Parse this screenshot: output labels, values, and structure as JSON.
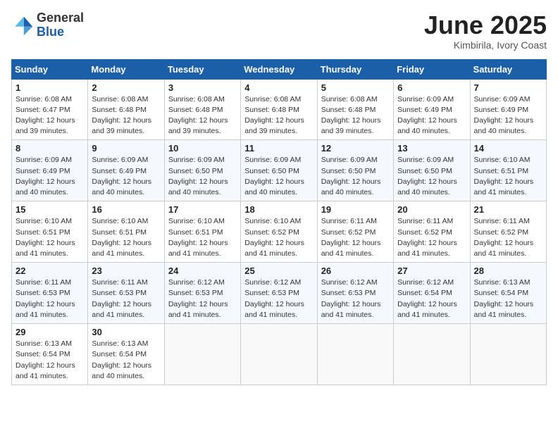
{
  "header": {
    "logo_general": "General",
    "logo_blue": "Blue",
    "month_title": "June 2025",
    "location": "Kimbirila, Ivory Coast"
  },
  "calendar": {
    "days_of_week": [
      "Sunday",
      "Monday",
      "Tuesday",
      "Wednesday",
      "Thursday",
      "Friday",
      "Saturday"
    ],
    "weeks": [
      [
        {
          "day": "1",
          "info": "Sunrise: 6:08 AM\nSunset: 6:47 PM\nDaylight: 12 hours\nand 39 minutes."
        },
        {
          "day": "2",
          "info": "Sunrise: 6:08 AM\nSunset: 6:48 PM\nDaylight: 12 hours\nand 39 minutes."
        },
        {
          "day": "3",
          "info": "Sunrise: 6:08 AM\nSunset: 6:48 PM\nDaylight: 12 hours\nand 39 minutes."
        },
        {
          "day": "4",
          "info": "Sunrise: 6:08 AM\nSunset: 6:48 PM\nDaylight: 12 hours\nand 39 minutes."
        },
        {
          "day": "5",
          "info": "Sunrise: 6:08 AM\nSunset: 6:48 PM\nDaylight: 12 hours\nand 39 minutes."
        },
        {
          "day": "6",
          "info": "Sunrise: 6:09 AM\nSunset: 6:49 PM\nDaylight: 12 hours\nand 40 minutes."
        },
        {
          "day": "7",
          "info": "Sunrise: 6:09 AM\nSunset: 6:49 PM\nDaylight: 12 hours\nand 40 minutes."
        }
      ],
      [
        {
          "day": "8",
          "info": "Sunrise: 6:09 AM\nSunset: 6:49 PM\nDaylight: 12 hours\nand 40 minutes."
        },
        {
          "day": "9",
          "info": "Sunrise: 6:09 AM\nSunset: 6:49 PM\nDaylight: 12 hours\nand 40 minutes."
        },
        {
          "day": "10",
          "info": "Sunrise: 6:09 AM\nSunset: 6:50 PM\nDaylight: 12 hours\nand 40 minutes."
        },
        {
          "day": "11",
          "info": "Sunrise: 6:09 AM\nSunset: 6:50 PM\nDaylight: 12 hours\nand 40 minutes."
        },
        {
          "day": "12",
          "info": "Sunrise: 6:09 AM\nSunset: 6:50 PM\nDaylight: 12 hours\nand 40 minutes."
        },
        {
          "day": "13",
          "info": "Sunrise: 6:09 AM\nSunset: 6:50 PM\nDaylight: 12 hours\nand 40 minutes."
        },
        {
          "day": "14",
          "info": "Sunrise: 6:10 AM\nSunset: 6:51 PM\nDaylight: 12 hours\nand 41 minutes."
        }
      ],
      [
        {
          "day": "15",
          "info": "Sunrise: 6:10 AM\nSunset: 6:51 PM\nDaylight: 12 hours\nand 41 minutes."
        },
        {
          "day": "16",
          "info": "Sunrise: 6:10 AM\nSunset: 6:51 PM\nDaylight: 12 hours\nand 41 minutes."
        },
        {
          "day": "17",
          "info": "Sunrise: 6:10 AM\nSunset: 6:51 PM\nDaylight: 12 hours\nand 41 minutes."
        },
        {
          "day": "18",
          "info": "Sunrise: 6:10 AM\nSunset: 6:52 PM\nDaylight: 12 hours\nand 41 minutes."
        },
        {
          "day": "19",
          "info": "Sunrise: 6:11 AM\nSunset: 6:52 PM\nDaylight: 12 hours\nand 41 minutes."
        },
        {
          "day": "20",
          "info": "Sunrise: 6:11 AM\nSunset: 6:52 PM\nDaylight: 12 hours\nand 41 minutes."
        },
        {
          "day": "21",
          "info": "Sunrise: 6:11 AM\nSunset: 6:52 PM\nDaylight: 12 hours\nand 41 minutes."
        }
      ],
      [
        {
          "day": "22",
          "info": "Sunrise: 6:11 AM\nSunset: 6:53 PM\nDaylight: 12 hours\nand 41 minutes."
        },
        {
          "day": "23",
          "info": "Sunrise: 6:11 AM\nSunset: 6:53 PM\nDaylight: 12 hours\nand 41 minutes."
        },
        {
          "day": "24",
          "info": "Sunrise: 6:12 AM\nSunset: 6:53 PM\nDaylight: 12 hours\nand 41 minutes."
        },
        {
          "day": "25",
          "info": "Sunrise: 6:12 AM\nSunset: 6:53 PM\nDaylight: 12 hours\nand 41 minutes."
        },
        {
          "day": "26",
          "info": "Sunrise: 6:12 AM\nSunset: 6:53 PM\nDaylight: 12 hours\nand 41 minutes."
        },
        {
          "day": "27",
          "info": "Sunrise: 6:12 AM\nSunset: 6:54 PM\nDaylight: 12 hours\nand 41 minutes."
        },
        {
          "day": "28",
          "info": "Sunrise: 6:13 AM\nSunset: 6:54 PM\nDaylight: 12 hours\nand 41 minutes."
        }
      ],
      [
        {
          "day": "29",
          "info": "Sunrise: 6:13 AM\nSunset: 6:54 PM\nDaylight: 12 hours\nand 41 minutes."
        },
        {
          "day": "30",
          "info": "Sunrise: 6:13 AM\nSunset: 6:54 PM\nDaylight: 12 hours\nand 40 minutes."
        },
        {
          "day": "",
          "info": ""
        },
        {
          "day": "",
          "info": ""
        },
        {
          "day": "",
          "info": ""
        },
        {
          "day": "",
          "info": ""
        },
        {
          "day": "",
          "info": ""
        }
      ]
    ]
  }
}
